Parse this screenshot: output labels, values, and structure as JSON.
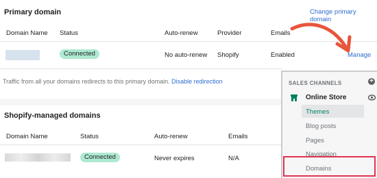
{
  "primary": {
    "title": "Primary domain",
    "change_link": "Change primary domain",
    "headers": [
      "Domain Name",
      "Status",
      "Auto-renew",
      "Provider",
      "Emails"
    ],
    "row": {
      "status": "Connected",
      "auto_renew": "No auto-renew",
      "provider": "Shopify",
      "emails": "Enabled",
      "action": "Manage"
    },
    "redirect_note": "Traffic from all your domains redirects to this primary domain.",
    "redirect_link": "Disable redirection"
  },
  "managed": {
    "title": "Shopify-managed domains",
    "headers": [
      "Domain Name",
      "Status",
      "Auto-renew",
      "Emails"
    ],
    "row": {
      "status": "Connected",
      "auto_renew": "Never expires",
      "emails": "N/A"
    }
  },
  "sidebar": {
    "section": "SALES CHANNELS",
    "store": "Online Store",
    "items": [
      "Themes",
      "Blog posts",
      "Pages",
      "Navigation",
      "Domains"
    ]
  },
  "colors": {
    "accent": "#2c6ecb",
    "badge": "#aee9d1",
    "arrow": "#e8553c",
    "highlight": "#e0324f",
    "store_icon": "#008060"
  }
}
